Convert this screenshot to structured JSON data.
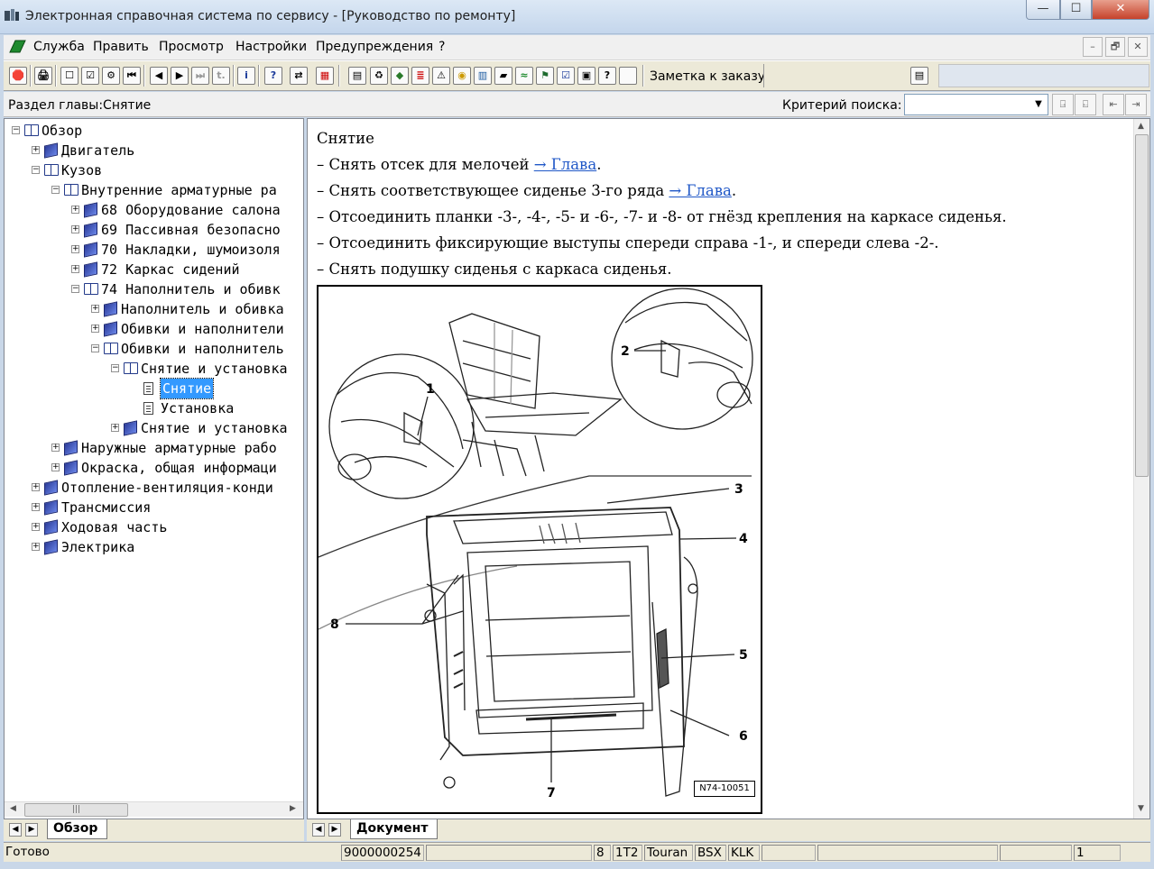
{
  "window": {
    "title": "Электронная справочная система по сервису - [Руководство по ремонту]",
    "min": "—",
    "max": "☐",
    "close": "✕"
  },
  "menu": {
    "items": [
      "Служба",
      "Править",
      "Просмотр",
      "Настройки",
      "Предупреждения",
      "?"
    ],
    "mdi": [
      "–",
      "🗗",
      "✕"
    ]
  },
  "toolbar": {
    "buttons": [
      "🛑",
      "🖨",
      "☐",
      "☑",
      "⚙",
      "⏮",
      "◀",
      "▶",
      "⏭",
      "t.",
      "i",
      "?",
      "⇄",
      "▦",
      "▤",
      "♻",
      "◆",
      "≣",
      "⚠",
      "◉",
      "▥",
      "▰",
      "≈",
      "⚑",
      "☑",
      "▣",
      "?"
    ],
    "order_note_label": "Заметка к заказу:",
    "order_note_btn": "▤"
  },
  "section": {
    "label": "Раздел главы:Снятие",
    "search_label": "Критерий  поиска:",
    "search_value": "",
    "search_arrow": "▼",
    "buttons": [
      "⍈",
      "⍇",
      "⇤",
      "⇥"
    ]
  },
  "tree": {
    "nodes": [
      {
        "label": "Обзор",
        "level": 0,
        "expander": "−",
        "icon": "open-book"
      },
      {
        "label": "Двигатель",
        "level": 1,
        "expander": "+",
        "icon": "book"
      },
      {
        "label": "Кузов",
        "level": 1,
        "expander": "−",
        "icon": "open-book"
      },
      {
        "label": "Внутренние арматурные ра",
        "level": 2,
        "expander": "−",
        "icon": "open-book"
      },
      {
        "label": "68 Оборудование салона",
        "level": 3,
        "expander": "+",
        "icon": "book"
      },
      {
        "label": "69 Пассивная безопасно",
        "level": 3,
        "expander": "+",
        "icon": "book"
      },
      {
        "label": "70 Накладки, шумоизоля",
        "level": 3,
        "expander": "+",
        "icon": "book"
      },
      {
        "label": "72 Каркас сидений",
        "level": 3,
        "expander": "+",
        "icon": "book"
      },
      {
        "label": "74 Наполнитель и обивк",
        "level": 3,
        "expander": "−",
        "icon": "open-book"
      },
      {
        "label": "Наполнитель и обивка",
        "level": 4,
        "expander": "+",
        "icon": "book"
      },
      {
        "label": "Обивки и наполнители",
        "level": 4,
        "expander": "+",
        "icon": "book"
      },
      {
        "label": "Обивки и наполнитель",
        "level": 4,
        "expander": "−",
        "icon": "open-book"
      },
      {
        "label": "Снятие и установка",
        "level": 5,
        "expander": "−",
        "icon": "open-book"
      },
      {
        "label": "Снятие",
        "level": 6,
        "expander": "",
        "icon": "page",
        "selected": true
      },
      {
        "label": "Установка",
        "level": 6,
        "expander": "",
        "icon": "page"
      },
      {
        "label": "Снятие и установка",
        "level": 5,
        "expander": "+",
        "icon": "book"
      },
      {
        "label": "Наружные арматурные рабо",
        "level": 2,
        "expander": "+",
        "icon": "book"
      },
      {
        "label": "Окраска, общая информаци",
        "level": 2,
        "expander": "+",
        "icon": "book"
      },
      {
        "label": "Отопление-вентиляция-конди",
        "level": 1,
        "expander": "+",
        "icon": "book"
      },
      {
        "label": "Трансмиссия",
        "level": 1,
        "expander": "+",
        "icon": "book"
      },
      {
        "label": "Ходовая часть",
        "level": 1,
        "expander": "+",
        "icon": "book"
      },
      {
        "label": "Электрика",
        "level": 1,
        "expander": "+",
        "icon": "book"
      }
    ],
    "tab_label": "Обзор"
  },
  "document": {
    "heading": "Снятие",
    "steps": [
      {
        "text": "–  Снять отсек для мелочей ",
        "link": "→ Глава",
        "after": "."
      },
      {
        "text": "–  Снять соответствующее сиденье 3-го ряда ",
        "link": "→ Глава",
        "after": "."
      },
      {
        "text": "–  Отсоединить планки -3-, -4-, -5- и -6-, -7- и -8- от гнёзд крепления на каркасе сиденья.",
        "link": "",
        "after": ""
      },
      {
        "text": "–  Отсоединить фиксирующие выступы спереди справа -1-, и спереди слева -2-.",
        "link": "",
        "after": ""
      },
      {
        "text": "–  Снять подушку сиденья с каркаса сиденья.",
        "link": "",
        "after": ""
      }
    ],
    "figure": {
      "callouts": [
        "1",
        "2",
        "3",
        "4",
        "5",
        "6",
        "7",
        "8"
      ],
      "code": "N74-10051"
    },
    "tab_label": "Документ"
  },
  "status": {
    "ready": "Готово",
    "order": "9000000254",
    "blank1": "",
    "c1": "8",
    "c2": "1T2",
    "c3": "Touran",
    "c4": "BSX",
    "c5": "KLK",
    "blank2": "",
    "blank3": "",
    "blank4": "",
    "page": "1"
  }
}
